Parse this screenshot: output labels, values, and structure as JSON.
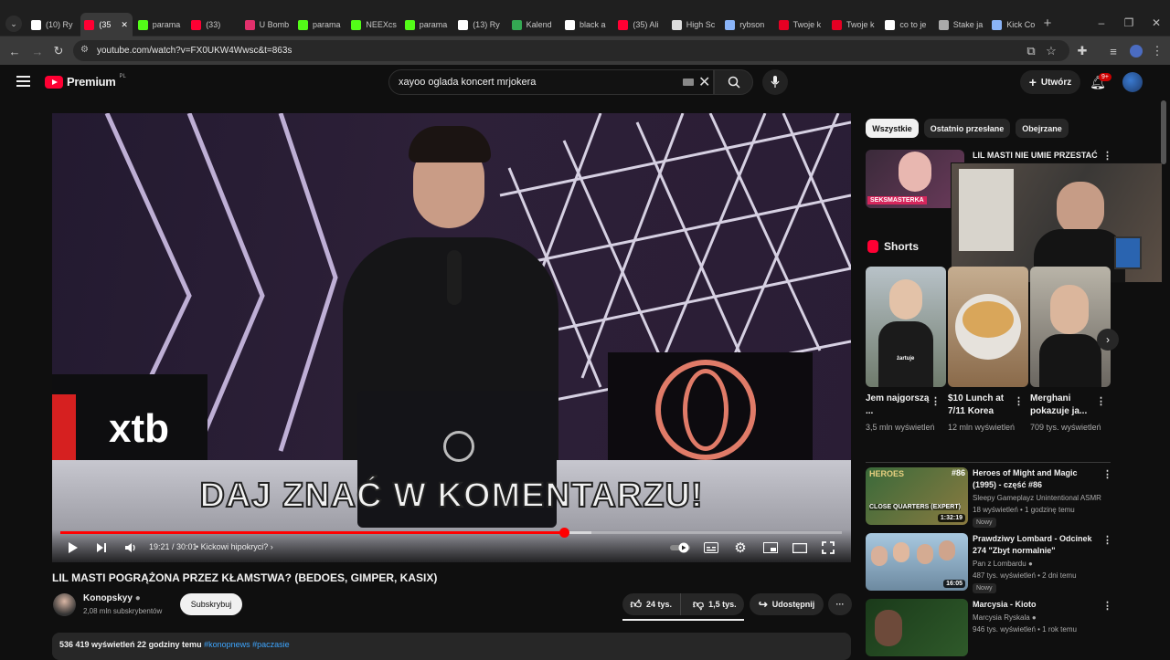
{
  "browser": {
    "tabs": [
      {
        "title": "(10) Ry",
        "icon": "x-logo-icon",
        "color": "#ffffff",
        "active": false
      },
      {
        "title": "(35",
        "icon": "youtube-icon",
        "color": "#ff0033",
        "active": true
      },
      {
        "title": "parama",
        "icon": "kick-icon",
        "color": "#53fc18",
        "active": false
      },
      {
        "title": "(33)",
        "icon": "youtube-icon",
        "color": "#ff0033",
        "active": false
      },
      {
        "title": "U Bomb",
        "icon": "instagram-icon",
        "color": "#e1306c",
        "active": false
      },
      {
        "title": "parama",
        "icon": "kick-icon",
        "color": "#53fc18",
        "active": false
      },
      {
        "title": "NEEXcs",
        "icon": "kick-icon",
        "color": "#53fc18",
        "active": false
      },
      {
        "title": "parama",
        "icon": "kick-icon",
        "color": "#53fc18",
        "active": false
      },
      {
        "title": "(13) Ry",
        "icon": "x-logo-icon",
        "color": "#ffffff",
        "active": false
      },
      {
        "title": "Kalend",
        "icon": "sheets-icon",
        "color": "#34a853",
        "active": false
      },
      {
        "title": "black a",
        "icon": "google-icon",
        "color": "#ffffff",
        "active": false
      },
      {
        "title": "(35) Ali",
        "icon": "youtube-icon",
        "color": "#ff0033",
        "active": false
      },
      {
        "title": "High Sc",
        "icon": "site-icon",
        "color": "#dddddd",
        "active": false
      },
      {
        "title": "rybson",
        "icon": "swirl-icon",
        "color": "#8ab4f8",
        "active": false
      },
      {
        "title": "Twoje k",
        "icon": "pinterest-icon",
        "color": "#e60023",
        "active": false
      },
      {
        "title": "Twoje k",
        "icon": "pinterest-icon",
        "color": "#e60023",
        "active": false
      },
      {
        "title": "co to je",
        "icon": "google-icon",
        "color": "#ffffff",
        "active": false
      },
      {
        "title": "Stake ja",
        "icon": "globe-icon",
        "color": "#aaaaaa",
        "active": false
      },
      {
        "title": "Kick Co",
        "icon": "swirl-icon",
        "color": "#8ab4f8",
        "active": false
      }
    ],
    "url": "youtube.com/watch?v=FX0UKW4Wwsc&t=863s"
  },
  "header": {
    "logo_text": "Premium",
    "logo_country": "PL",
    "search_value": "xayoo oglada koncert mrjokera",
    "create_label": "Utwórz",
    "notif_count": "9+"
  },
  "player": {
    "overlay_caption": "DAJ ZNAĆ W KOMENTARZU!",
    "sponsor": "xtb",
    "time": "19:21 / 30:01",
    "chapter": "Kickowi hipokryci?",
    "progress_fraction": 0.645
  },
  "video": {
    "title": "LIL MASTI POGRĄŻONA PRZEZ KŁAMSTWA? (BEDOES, GIMPER, KASIX)",
    "channel": "Konopskyy",
    "subscribers": "2,08 mln subskrybentów",
    "subscribe_label": "Subskrybuj",
    "likes": "24 tys.",
    "dislikes": "1,5 tys.",
    "share_label": "Udostępnij",
    "description_stats": "536 419 wyświetleń  22 godziny temu",
    "description_tags": "#konopnews #paczasie"
  },
  "sidebar": {
    "chips": [
      "Wszystkie",
      "Ostatnio przesłane",
      "Obejrzane"
    ],
    "top_item": {
      "title": "LIL MASTI NIE UMIE PRZESTAĆ",
      "thumb_text": "SEKSMASTERKA"
    },
    "shorts_title": "Shorts",
    "shorts": [
      {
        "title": "Jem najgorszą ...",
        "views": "3,5 mln wyświetleń",
        "thumb_text": "żartuje"
      },
      {
        "title": "$10 Lunch at 7/11 Korea",
        "views": "12 mln wyświetleń"
      },
      {
        "title": "Merghani pokazuje ja...",
        "views": "709 tys. wyświetleń"
      }
    ],
    "videos": [
      {
        "title": "Heroes of Might and Magic (1995) - część #86",
        "channel": "Sleepy Gameplayz Unintentional ASMR",
        "meta": "18 wyświetleń • 1 godzinę temu",
        "badge": "Nowy",
        "duration": "1:32:19",
        "thumb_text": "CLOSE QUARTERS (EXPERT)",
        "thumb_num": "#86",
        "thumb_logo": "HEROES"
      },
      {
        "title": "Prawdziwy Lombard - Odcinek 274 \"Zbyt normalnie\"",
        "channel": "Pan z Lombardu",
        "meta": "487 tys. wyświetleń • 2 dni temu",
        "badge": "Nowy",
        "duration": "16:05"
      },
      {
        "title": "Marcysia - Kioto",
        "channel": "Marcysia Ryskala",
        "meta": "946 tys. wyświetleń • 1 rok temu",
        "badge": "",
        "duration": ""
      }
    ]
  }
}
